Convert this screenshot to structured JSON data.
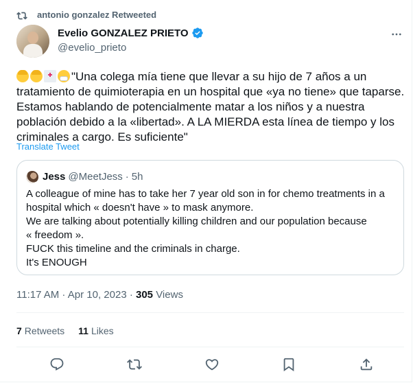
{
  "retweet_bar": {
    "text": "antonio gonzalez Retweeted",
    "icon": "retweet-icon"
  },
  "author": {
    "display_name": "Evelio GONZALEZ PRIETO",
    "handle": "@evelio_prieto",
    "verified": true,
    "verified_color": "#1d9bf0"
  },
  "tweet": {
    "emoji_icons": [
      "woman-blond-emoji",
      "woman-blond-emoji",
      "hospital-emoji",
      "face-with-mask-emoji"
    ],
    "text": "\"Una colega mía tiene que llevar a su hijo de 7 años a un tratamiento de quimioterapia en un hospital que «ya no tiene» que taparse. Estamos hablando de potencialmente matar a los niños y a nuestra población debido a la «libertad». A LA MIERDA esta línea de tiempo y los criminales a cargo. Es suficiente\"",
    "translate_label": "Translate Tweet"
  },
  "quoted_tweet": {
    "name": "Jess",
    "handle": "@MeetJess",
    "separator": "·",
    "time": "5h",
    "lines": [
      "A colleague of mine has to take her 7 year old son in for chemo treatments in a",
      "hospital which « doesn't have » to mask anymore.",
      "We are talking about potentially killing children and our population because",
      "« freedom ».",
      "FUCK this timeline and the criminals in charge.",
      "It's ENOUGH"
    ]
  },
  "meta": {
    "timestamp": "11:17 AM · Apr 10, 2023 · ",
    "views_count": "305",
    "views_label": " Views"
  },
  "stats": {
    "retweets_count": "7",
    "retweets_label": "Retweets",
    "likes_count": "11",
    "likes_label": "Likes"
  },
  "actions": [
    "reply-icon",
    "retweet-icon",
    "like-icon",
    "bookmark-icon",
    "share-icon"
  ],
  "colors": {
    "text_primary": "#0f1419",
    "text_secondary": "#536471",
    "accent": "#1d9bf0",
    "border": "#cfd9de"
  }
}
